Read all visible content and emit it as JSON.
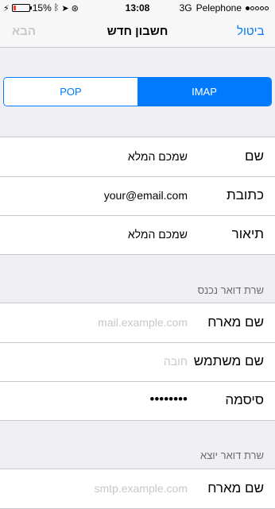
{
  "status_bar": {
    "battery_percent": "15%",
    "battery_level": 0.15,
    "time": "13:08",
    "network": "3G",
    "carrier": "Pelephone"
  },
  "nav": {
    "title": "חשבון חדש",
    "cancel": "ביטול",
    "next": "הבא"
  },
  "segment": {
    "pop": "POP",
    "imap": "IMAP",
    "selected": "IMAP"
  },
  "account": {
    "name_label": "שם",
    "name_value": "שמכם המלא",
    "address_label": "כתובת",
    "address_value": "your@email.com",
    "description_label": "תיאור",
    "description_value": "שמכם המלא"
  },
  "incoming": {
    "header": "שרת דואר נכנס",
    "host_label": "שם מארח",
    "host_placeholder": "mail.example.com",
    "user_label": "שם משתמש",
    "user_placeholder": "חובה",
    "password_label": "סיסמה",
    "password_value": "••••••••"
  },
  "outgoing": {
    "header": "שרת דואר יוצא",
    "host_label": "שם מארח",
    "host_placeholder": "smtp.example.com"
  }
}
